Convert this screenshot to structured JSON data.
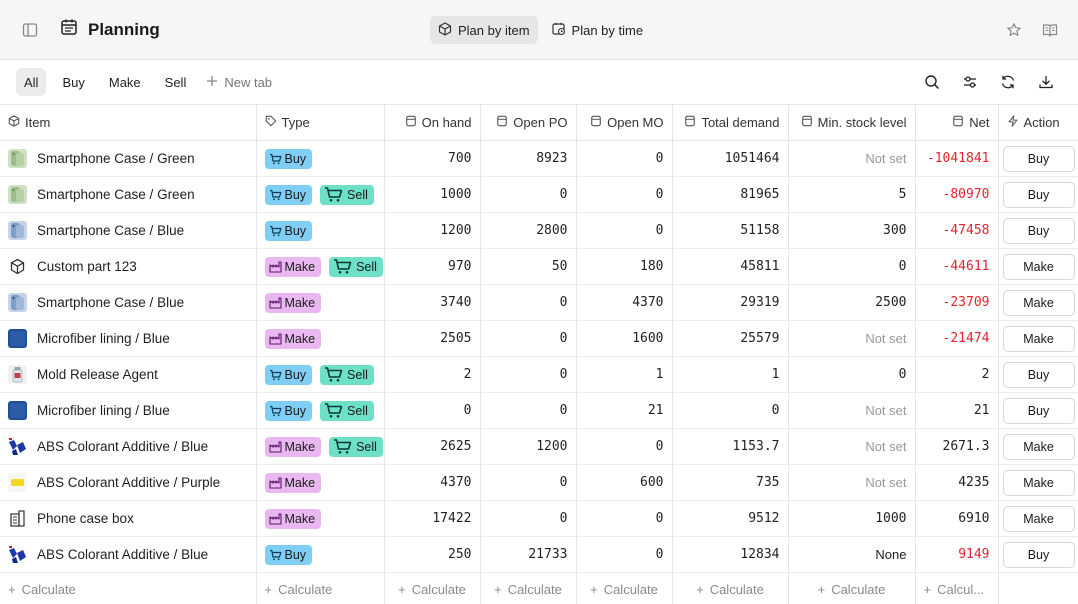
{
  "header": {
    "title": "Planning",
    "views": [
      {
        "label": "Plan by item",
        "active": true
      },
      {
        "label": "Plan by time",
        "active": false
      }
    ]
  },
  "tabs": {
    "items": [
      "All",
      "Buy",
      "Make",
      "Sell"
    ],
    "active": "All",
    "new_tab_label": "New tab"
  },
  "columns": {
    "item": "Item",
    "type": "Type",
    "on_hand": "On hand",
    "open_po": "Open PO",
    "open_mo": "Open MO",
    "total_demand": "Total demand",
    "min_stock": "Min. stock level",
    "net": "Net",
    "action": "Action"
  },
  "tag_labels": {
    "buy": "Buy",
    "make": "Make",
    "sell": "Sell"
  },
  "colors": {
    "buy": "#7fcff5",
    "make": "#e9b8f1",
    "sell": "#6ee0c8",
    "negative": "#e5222e"
  },
  "rows": [
    {
      "thumb": "green-case",
      "item": "Smartphone Case / Green",
      "tags": [
        "buy"
      ],
      "on_hand": "700",
      "open_po": "8923",
      "open_mo": "0",
      "total_demand": "1051464",
      "min_stock": "Not set",
      "net": "-1041841",
      "action": "Buy"
    },
    {
      "thumb": "green-case",
      "item": "Smartphone Case / Green",
      "tags": [
        "buy",
        "sell"
      ],
      "on_hand": "1000",
      "open_po": "0",
      "open_mo": "0",
      "total_demand": "81965",
      "min_stock": "5",
      "net": "-80970",
      "action": "Buy"
    },
    {
      "thumb": "blue-case",
      "item": "Smartphone Case / Blue",
      "tags": [
        "buy"
      ],
      "on_hand": "1200",
      "open_po": "2800",
      "open_mo": "0",
      "total_demand": "51158",
      "min_stock": "300",
      "net": "-47458",
      "action": "Buy"
    },
    {
      "thumb": "cube-icon",
      "item": "Custom part 123",
      "tags": [
        "make",
        "sell"
      ],
      "on_hand": "970",
      "open_po": "50",
      "open_mo": "180",
      "total_demand": "45811",
      "min_stock": "0",
      "net": "-44611",
      "action": "Make"
    },
    {
      "thumb": "blue-case",
      "item": "Smartphone Case / Blue",
      "tags": [
        "make"
      ],
      "on_hand": "3740",
      "open_po": "0",
      "open_mo": "4370",
      "total_demand": "29319",
      "min_stock": "2500",
      "net": "-23709",
      "action": "Make"
    },
    {
      "thumb": "blue-fabric",
      "item": "Microfiber lining / Blue",
      "tags": [
        "make"
      ],
      "on_hand": "2505",
      "open_po": "0",
      "open_mo": "1600",
      "total_demand": "25579",
      "min_stock": "Not set",
      "net": "-21474",
      "action": "Make"
    },
    {
      "thumb": "bottle",
      "item": "Mold Release Agent",
      "tags": [
        "buy",
        "sell"
      ],
      "on_hand": "2",
      "open_po": "0",
      "open_mo": "1",
      "total_demand": "1",
      "min_stock": "0",
      "net": "2",
      "action": "Buy"
    },
    {
      "thumb": "blue-fabric",
      "item": "Microfiber lining / Blue",
      "tags": [
        "buy",
        "sell"
      ],
      "on_hand": "0",
      "open_po": "0",
      "open_mo": "21",
      "total_demand": "0",
      "min_stock": "Not set",
      "net": "21",
      "action": "Buy"
    },
    {
      "thumb": "blue-pellets",
      "item": "ABS Colorant Additive / Blue",
      "tags": [
        "make",
        "sell"
      ],
      "on_hand": "2625",
      "open_po": "1200",
      "open_mo": "0",
      "total_demand": "1153.7",
      "min_stock": "Not set",
      "net": "2671.3",
      "action": "Make"
    },
    {
      "thumb": "yellow-pellets",
      "item": "ABS Colorant Additive / Purple",
      "tags": [
        "make"
      ],
      "on_hand": "4370",
      "open_po": "0",
      "open_mo": "600",
      "total_demand": "735",
      "min_stock": "Not set",
      "net": "4235",
      "action": "Make"
    },
    {
      "thumb": "building-icon",
      "item": "Phone case box",
      "tags": [
        "make"
      ],
      "on_hand": "17422",
      "open_po": "0",
      "open_mo": "0",
      "total_demand": "9512",
      "min_stock": "1000",
      "net": "6910",
      "action": "Make"
    },
    {
      "thumb": "blue-pellets",
      "item": "ABS Colorant Additive / Blue",
      "tags": [
        "buy"
      ],
      "on_hand": "250",
      "open_po": "21733",
      "open_mo": "0",
      "total_demand": "12834",
      "min_stock": "None",
      "net": "9149",
      "action": "Buy"
    }
  ],
  "footer": {
    "calc_label": "Calculate",
    "calc_label_short": "Calcul..."
  }
}
